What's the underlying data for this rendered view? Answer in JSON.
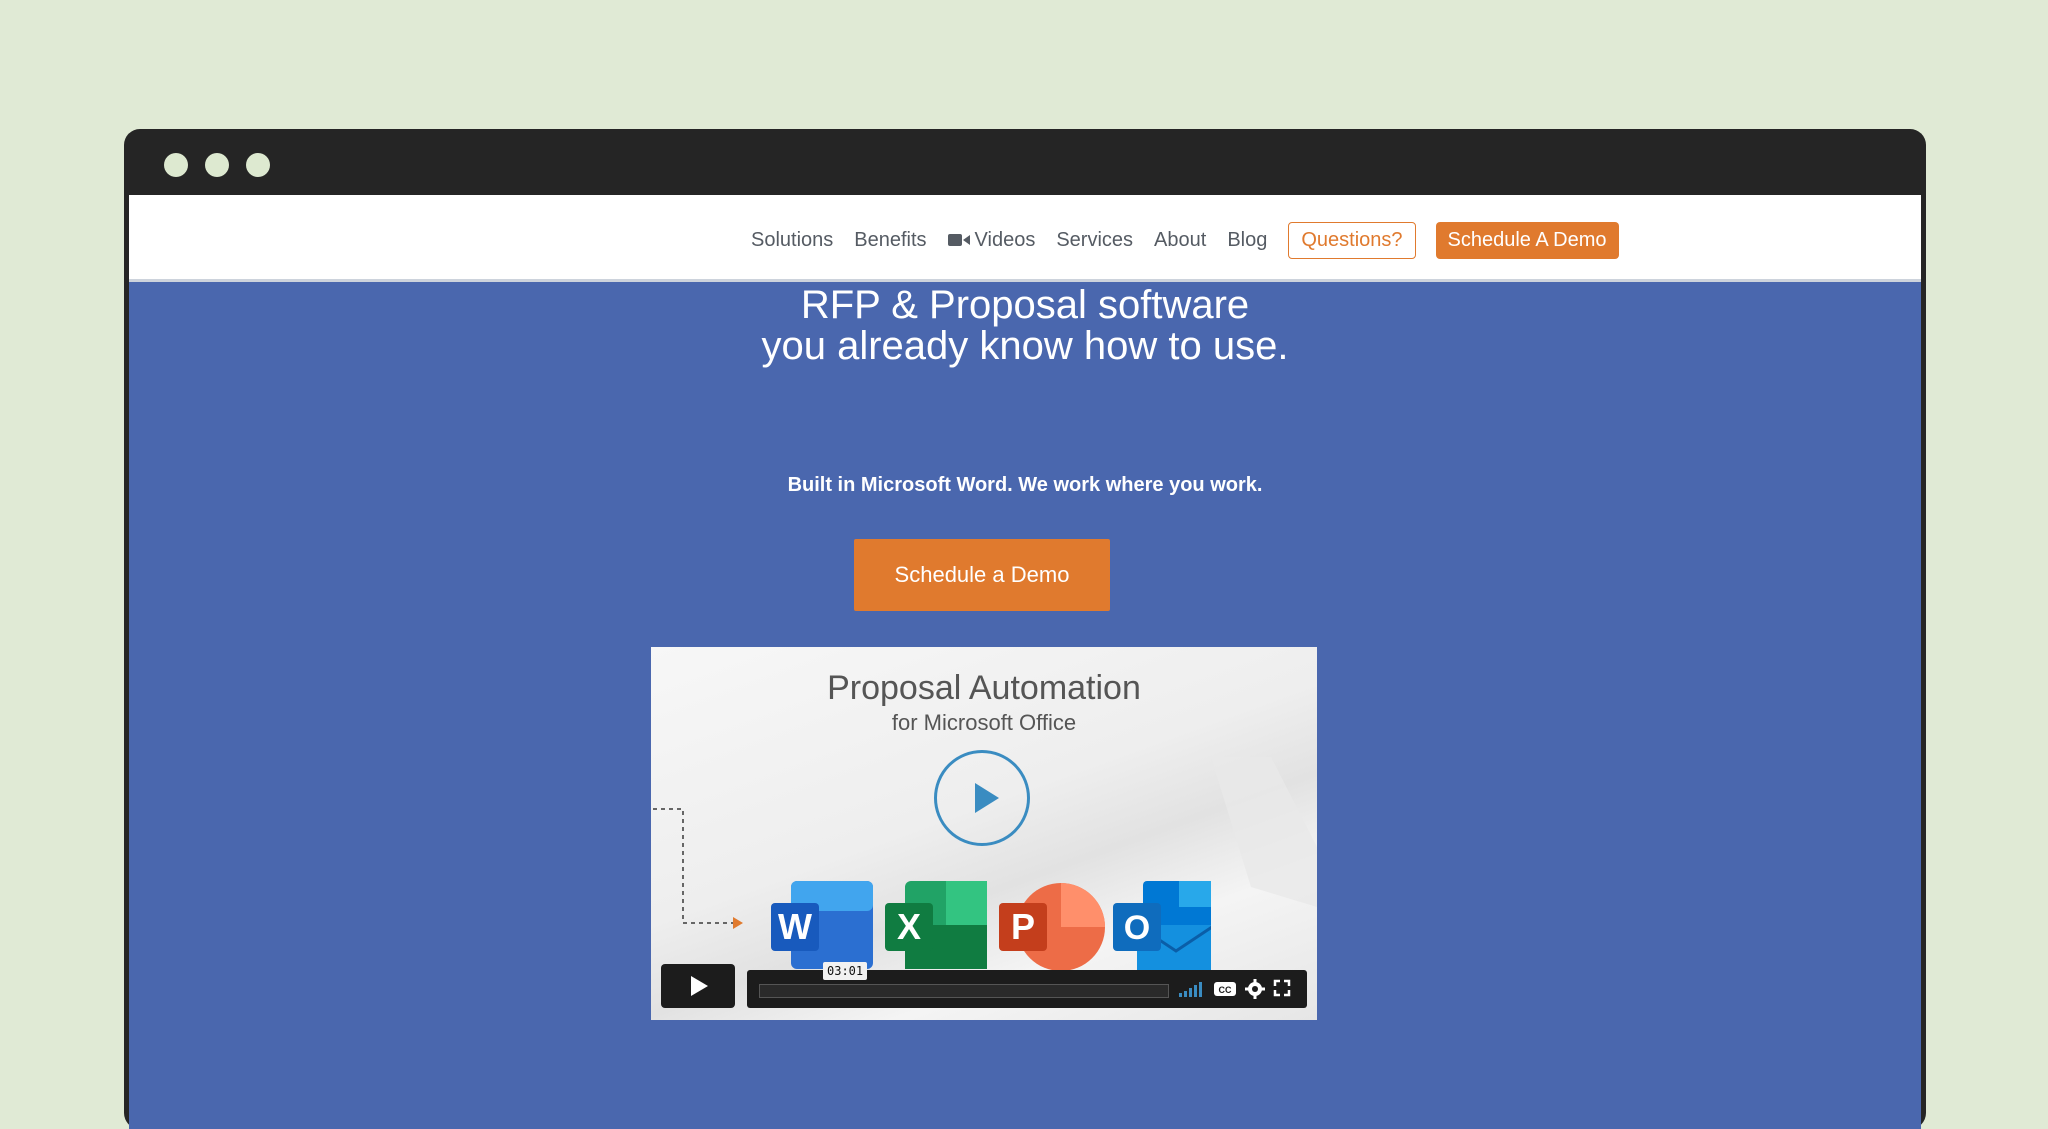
{
  "nav": {
    "items": [
      "Solutions",
      "Benefits",
      "Videos",
      "Services",
      "About",
      "Blog"
    ],
    "questions": "Questions?",
    "schedule": "Schedule A Demo"
  },
  "hero": {
    "title_line1": "RFP & Proposal software",
    "title_line2": "you already know how to use.",
    "subtitle": "Built in Microsoft Word. We work where you work.",
    "cta": "Schedule a Demo"
  },
  "video": {
    "title": "Proposal Automation",
    "subtitle": "for Microsoft Office",
    "time": "03:01",
    "progress": 0
  },
  "colors": {
    "accent": "#e07a2e",
    "hero_bg": "#4a67ae",
    "page_bg": "#e0ead5",
    "window_frame": "#252525"
  },
  "icons": [
    "video-camera-icon",
    "play-icon",
    "volume-icon",
    "closed-captions-icon",
    "settings-icon",
    "fullscreen-icon",
    "word-icon",
    "excel-icon",
    "powerpoint-icon",
    "outlook-icon"
  ]
}
